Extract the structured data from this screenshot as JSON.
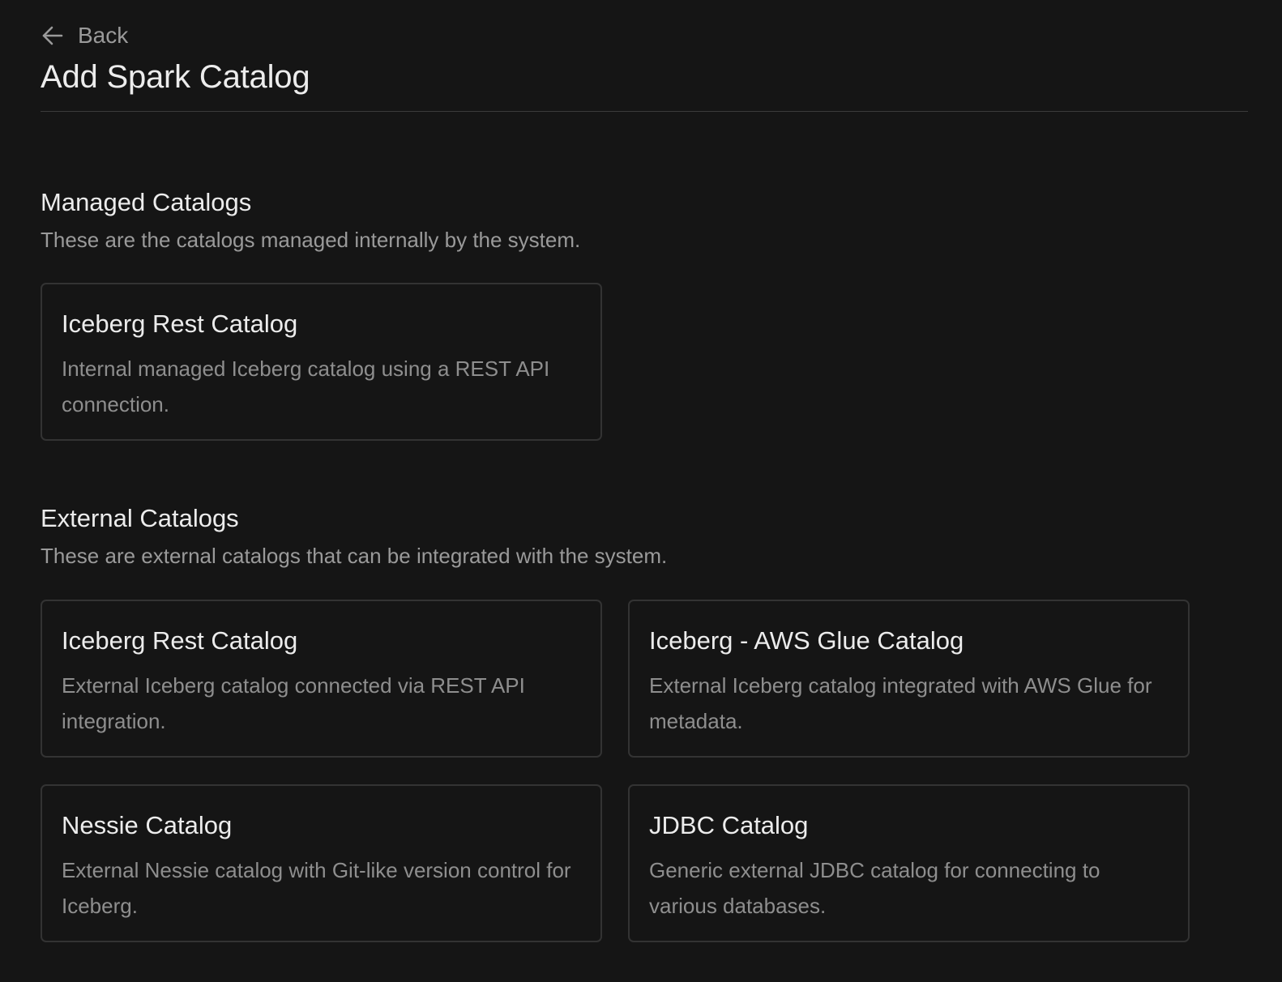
{
  "header": {
    "back_label": "Back",
    "title": "Add Spark Catalog"
  },
  "managed": {
    "title": "Managed Catalogs",
    "description": "These are the catalogs managed internally by the system.",
    "cards": [
      {
        "title": "Iceberg Rest Catalog",
        "description": "Internal managed Iceberg catalog using a REST API connection."
      }
    ]
  },
  "external": {
    "title": "External Catalogs",
    "description": "These are external catalogs that can be integrated with the system.",
    "cards": [
      {
        "title": "Iceberg Rest Catalog",
        "description": "External Iceberg catalog connected via REST API integration."
      },
      {
        "title": "Iceberg - AWS Glue Catalog",
        "description": "External Iceberg catalog integrated with AWS Glue for metadata."
      },
      {
        "title": "Nessie Catalog",
        "description": "External Nessie catalog with Git-like version control for Iceberg."
      },
      {
        "title": "JDBC Catalog",
        "description": "Generic external JDBC catalog for connecting to various databases."
      }
    ]
  },
  "icons": {
    "back": "arrow-left-icon"
  }
}
